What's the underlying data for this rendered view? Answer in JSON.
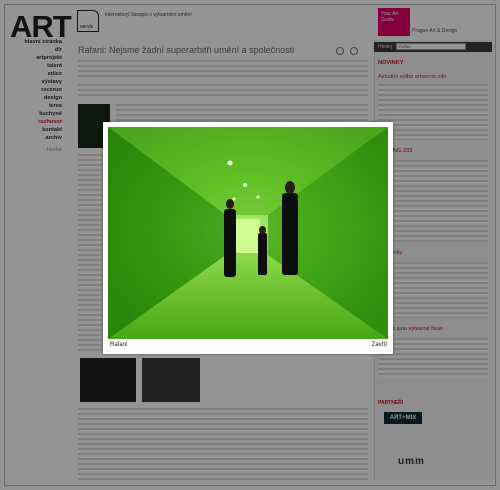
{
  "header": {
    "logo": "ART",
    "logo_sub": "servis",
    "tagline": "internetový časopis o výtvarném umění",
    "badge": "Your Art Guide",
    "partner": "Prague Art & Design"
  },
  "nav": {
    "items": [
      "hlavní stránka",
      "dlr",
      "artprojekt",
      "talent",
      "edice",
      "výstavy",
      "recenze",
      "design",
      "tema",
      "kuchyně",
      "rozhovor",
      "kontakt",
      "archiv"
    ],
    "active_index": 10,
    "search": "hledat"
  },
  "article": {
    "title": "Rafani: Nejsme žádní superarbitři umění a společnosti"
  },
  "sidebar": {
    "search_label": "Hledej",
    "search_value": "Rafan",
    "headings": [
      "NOVINKY",
      "Aktuální volba artservis.info",
      "Cena NG 333",
      "výtvarný",
      "Pozvánky",
      "Z čeho jsou výtvarné fleuri"
    ],
    "partners_label": "PARTNEŘI",
    "partner_logo": "ART+MIX",
    "umm_logo": "umm"
  },
  "lightbox": {
    "caption": "Rafani",
    "close_label": "Zavřít",
    "photo_bg": "#3fa21a"
  }
}
